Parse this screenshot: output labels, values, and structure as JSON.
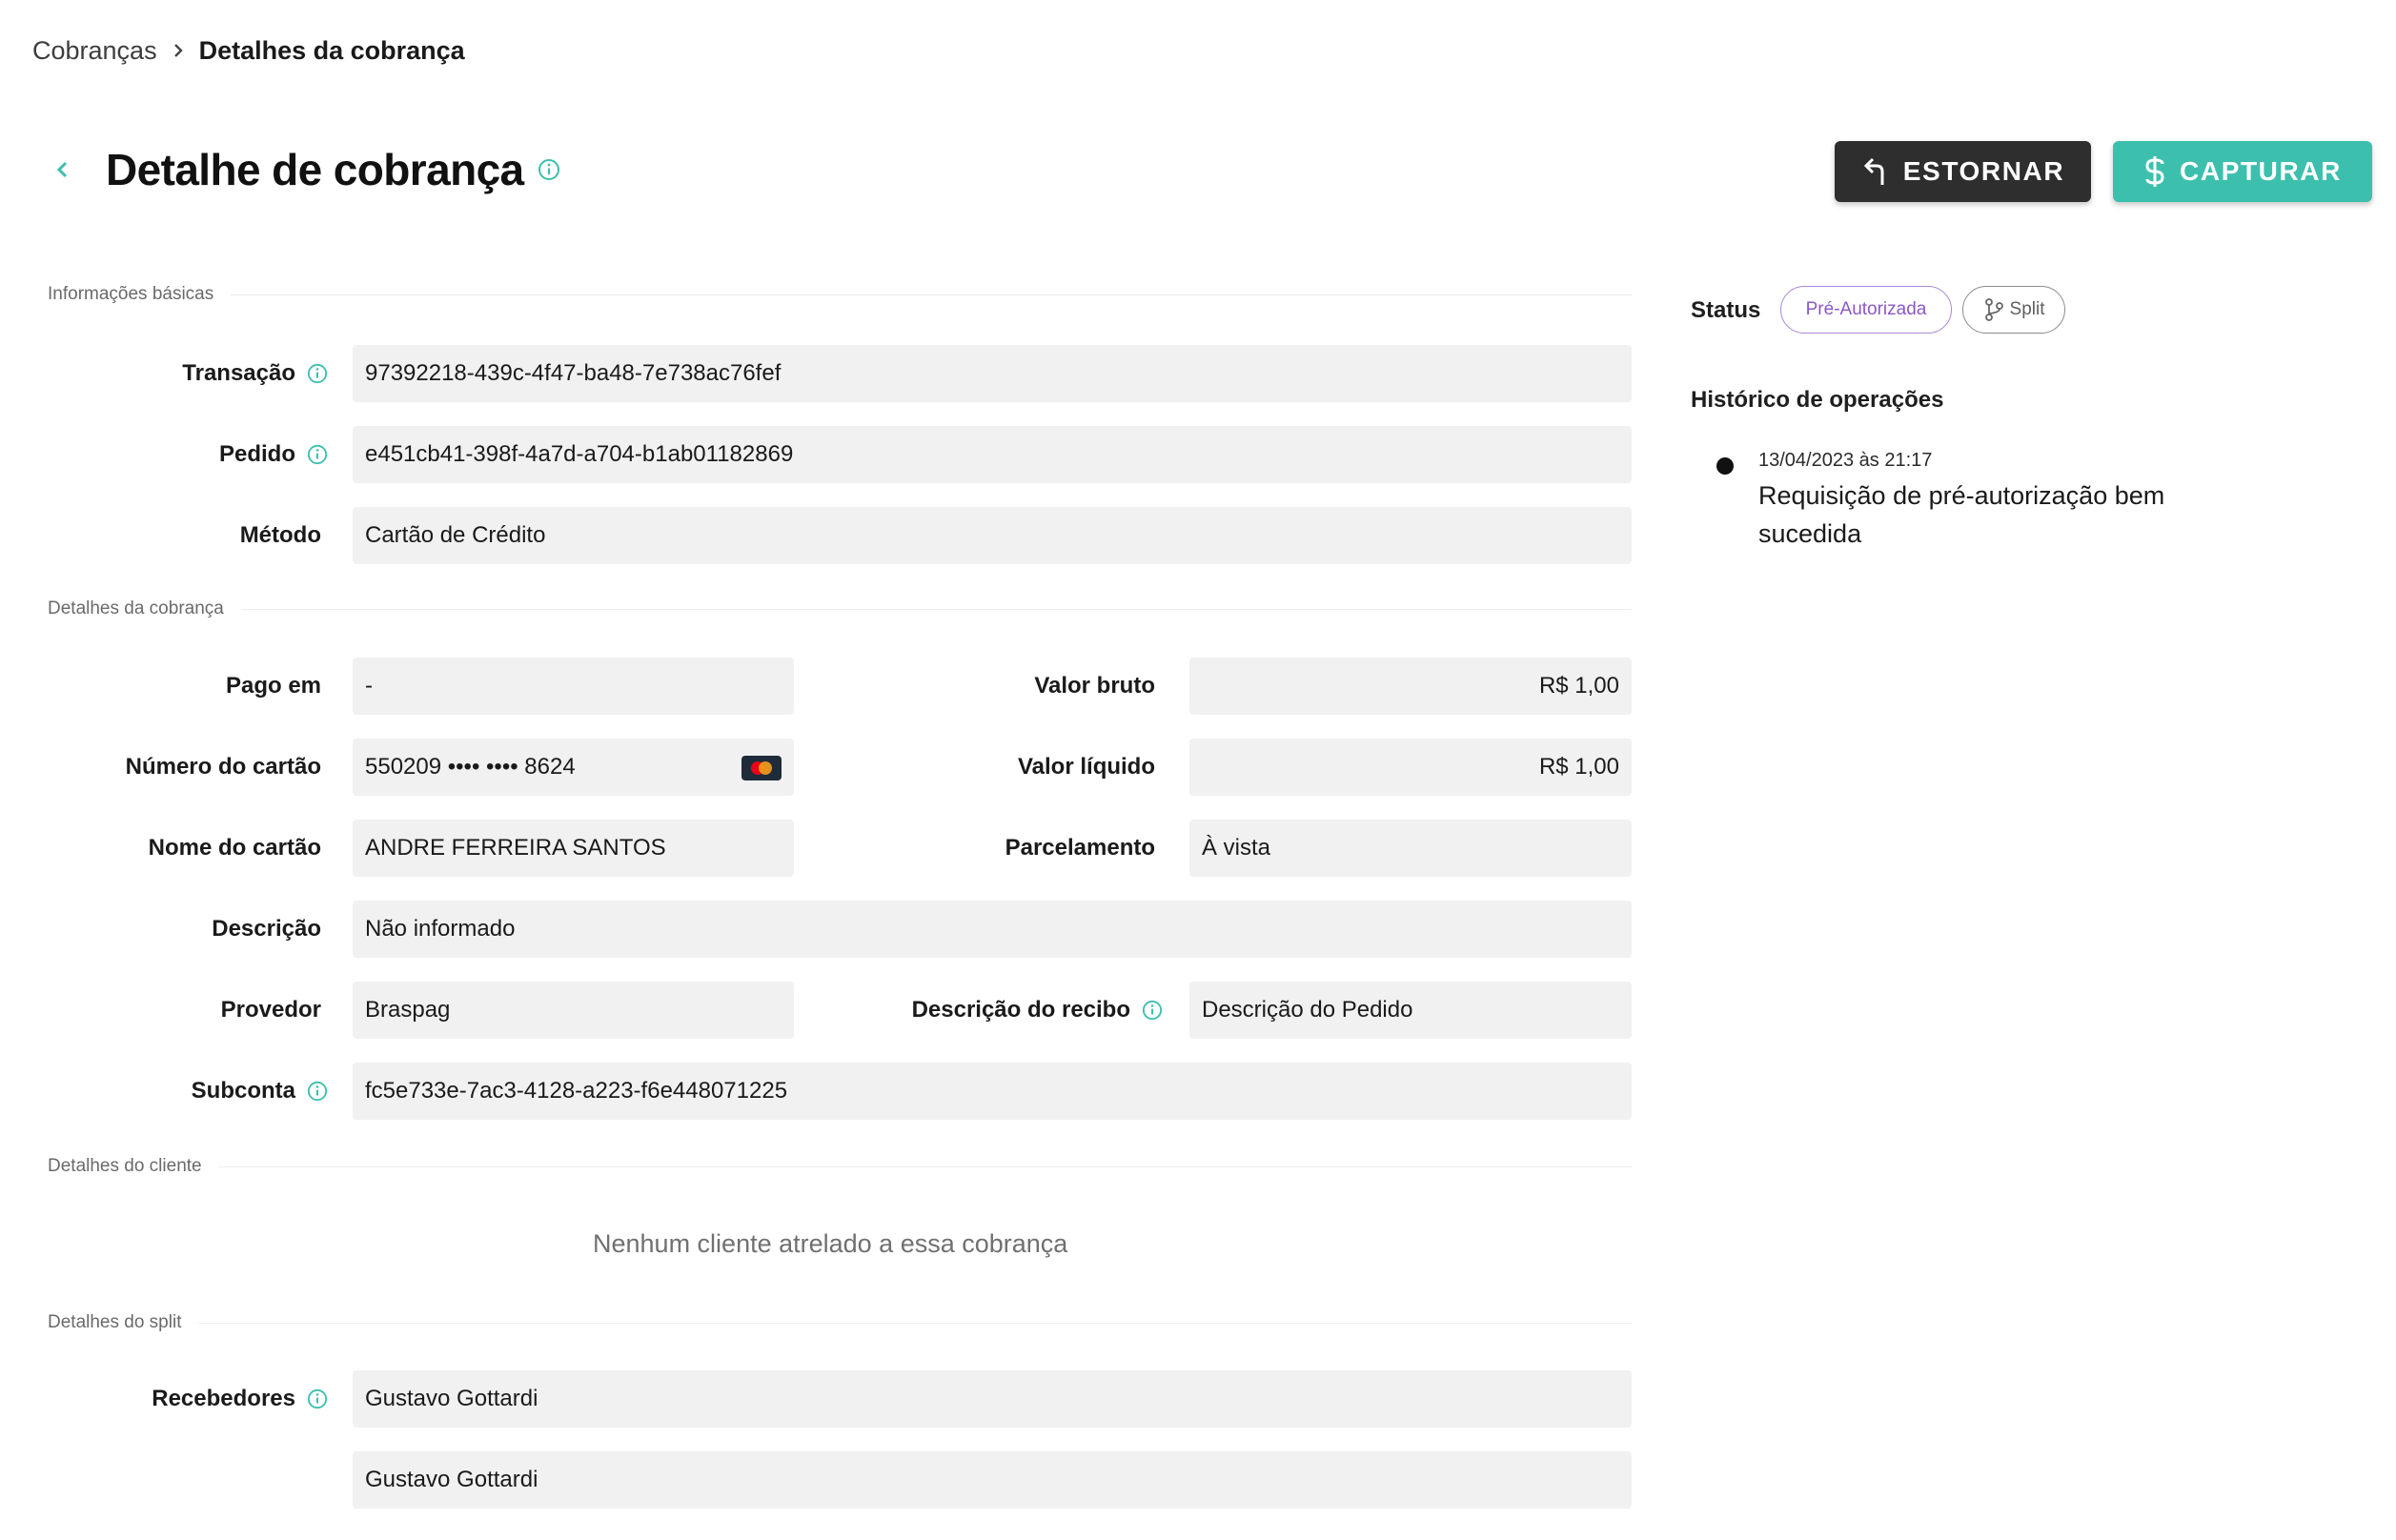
{
  "breadcrumb": {
    "parent": "Cobranças",
    "current": "Detalhes da cobrança"
  },
  "header": {
    "title": "Detalhe de cobrança"
  },
  "actions": {
    "estornar": "ESTORNAR",
    "capturar": "CAPTURAR"
  },
  "sections": {
    "basic": "Informações básicas",
    "charge": "Detalhes da cobrança",
    "client": "Detalhes do cliente",
    "split": "Detalhes do split"
  },
  "basic": {
    "transacao": {
      "label": "Transação",
      "value": "97392218-439c-4f47-ba48-7e738ac76fef"
    },
    "pedido": {
      "label": "Pedido",
      "value": "e451cb41-398f-4a7d-a704-b1ab01182869"
    },
    "metodo": {
      "label": "Método",
      "value": "Cartão de Crédito"
    }
  },
  "charge": {
    "pago_em": {
      "label": "Pago em",
      "value": "-"
    },
    "valor_bruto": {
      "label": "Valor bruto",
      "value": "R$ 1,00"
    },
    "numero_cartao": {
      "label": "Número do cartão",
      "value": "550209 •••• •••• 8624"
    },
    "valor_liquido": {
      "label": "Valor líquido",
      "value": "R$ 1,00"
    },
    "nome_cartao": {
      "label": "Nome do cartão",
      "value": "ANDRE FERREIRA SANTOS"
    },
    "parcelamento": {
      "label": "Parcelamento",
      "value": "À vista"
    },
    "descricao": {
      "label": "Descrição",
      "value": "Não informado"
    },
    "provedor": {
      "label": "Provedor",
      "value": "Braspag"
    },
    "descricao_recibo": {
      "label": "Descrição do recibo",
      "value": "Descrição do Pedido"
    },
    "subconta": {
      "label": "Subconta",
      "value": "fc5e733e-7ac3-4128-a223-f6e448071225"
    }
  },
  "client": {
    "empty_message": "Nenhum cliente atrelado a essa cobrança"
  },
  "split": {
    "label": "Recebedores",
    "receivers": [
      "Gustavo Gottardi",
      "Gustavo Gottardi"
    ]
  },
  "status_panel": {
    "label": "Status",
    "chips": [
      "Pré-Autorizada",
      "Split"
    ],
    "history_title": "Histórico de operações",
    "history": [
      {
        "date": "13/04/2023 às 21:17",
        "description": "Requisição de pré-autorização bem sucedida"
      }
    ]
  },
  "colors": {
    "accent": "#3dbfad",
    "dark": "#2e2e2e",
    "status_purple": "#8a58c8"
  }
}
